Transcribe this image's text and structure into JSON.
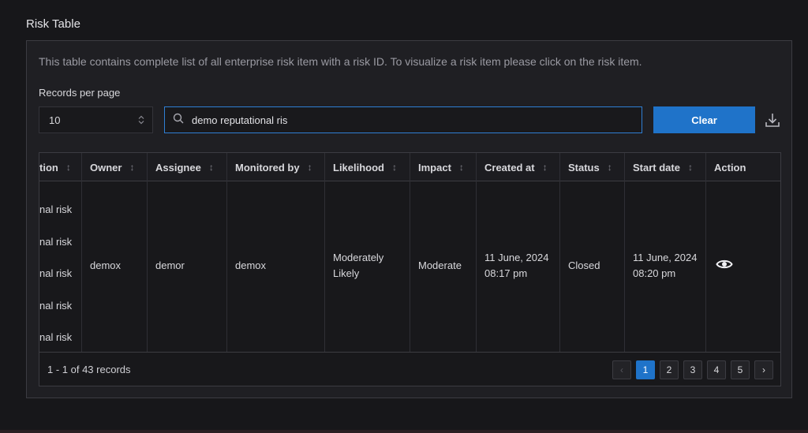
{
  "section_title": "Risk Table",
  "description": "This table contains complete list of all enterprise risk item with a risk ID. To visualize a risk item please click on the risk item.",
  "records_per_page": {
    "label": "Records per page",
    "value": "10"
  },
  "search": {
    "value": "demo reputational ris",
    "icon": "search-icon"
  },
  "clear_label": "Clear",
  "download_icon": "download-icon",
  "table": {
    "columns": [
      {
        "label": "tion"
      },
      {
        "label": "Owner"
      },
      {
        "label": "Assignee"
      },
      {
        "label": "Monitored by"
      },
      {
        "label": "Likelihood"
      },
      {
        "label": "Impact"
      },
      {
        "label": "Created at"
      },
      {
        "label": "Status"
      },
      {
        "label": "Start date"
      },
      {
        "label": "Action"
      }
    ],
    "sort_icon": "↕",
    "row": {
      "description_lines": [
        "nal risk",
        "nal risk",
        "nal risk",
        "nal risk",
        "nal risk"
      ],
      "owner": "demox",
      "assignee": "demor",
      "monitored_by": "demox",
      "likelihood": [
        "Moderately",
        "Likely"
      ],
      "impact": "Moderate",
      "created_at": [
        "11 June, 2024",
        "08:17 pm"
      ],
      "status": "Closed",
      "start_date": [
        "11 June, 2024",
        "08:20 pm"
      ],
      "action_icon": "eye-icon"
    }
  },
  "footer": {
    "records": "1 - 1 of 43 records",
    "pages": [
      "1",
      "2",
      "3",
      "4",
      "5"
    ],
    "active_page": "1",
    "prev": "‹",
    "next": "›"
  }
}
